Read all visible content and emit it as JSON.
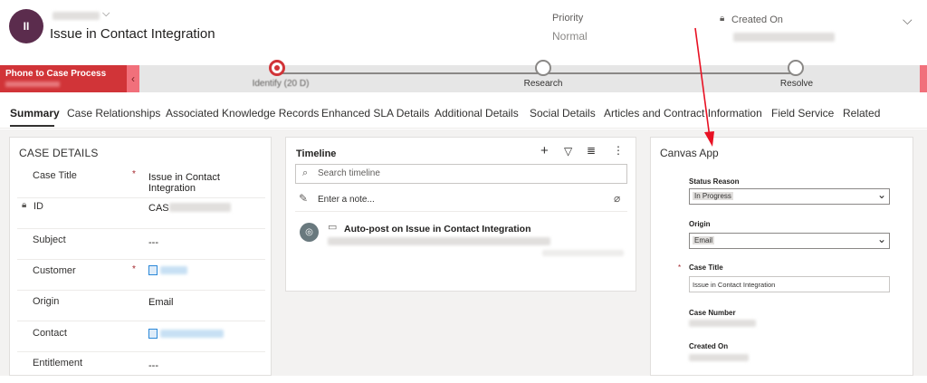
{
  "header": {
    "avatar_initials": "II",
    "title": "Issue in Contact Integration",
    "priority_label": "Priority",
    "priority_value": "Normal",
    "created_on_label": "Created On"
  },
  "bpf": {
    "process_name": "Phone to Case Process",
    "stages": [
      {
        "label": "Identify (20 D)"
      },
      {
        "label": "Research"
      },
      {
        "label": "Resolve"
      }
    ]
  },
  "tabs": [
    {
      "label": "Summary"
    },
    {
      "label": "Case Relationships"
    },
    {
      "label": "Associated Knowledge Records"
    },
    {
      "label": "Enhanced SLA Details"
    },
    {
      "label": "Additional Details"
    },
    {
      "label": "Social Details"
    },
    {
      "label": "Articles and Contract Information"
    },
    {
      "label": "Field Service"
    },
    {
      "label": "Related"
    }
  ],
  "case_details": {
    "title": "CASE DETAILS",
    "fields": [
      {
        "label": "Case Title",
        "value": "Issue in Contact Integration"
      },
      {
        "label": "ID",
        "value": "CAS"
      },
      {
        "label": "Subject",
        "value": "---"
      },
      {
        "label": "Customer",
        "value": ""
      },
      {
        "label": "Origin",
        "value": "Email"
      },
      {
        "label": "Contact",
        "value": ""
      },
      {
        "label": "Entitlement",
        "value": "---"
      }
    ],
    "required_mark": "*"
  },
  "timeline": {
    "title": "Timeline",
    "search_placeholder": "Search timeline",
    "note_placeholder": "Enter a note...",
    "post_title": "Auto-post on Issue in Contact Integration"
  },
  "canvas_app": {
    "title": "Canvas App",
    "status_reason_label": "Status Reason",
    "status_reason_value": "In Progress",
    "origin_label": "Origin",
    "origin_value": "Email",
    "case_title_label": "Case Title",
    "case_title_value": "Issue in Contact Integration",
    "case_number_label": "Case Number",
    "created_on_label": "Created On",
    "required_mark": "*"
  },
  "colors": {
    "accent_red": "#d13438",
    "avatar": "#5b2c4d",
    "annotation_arrow": "#e81123"
  }
}
